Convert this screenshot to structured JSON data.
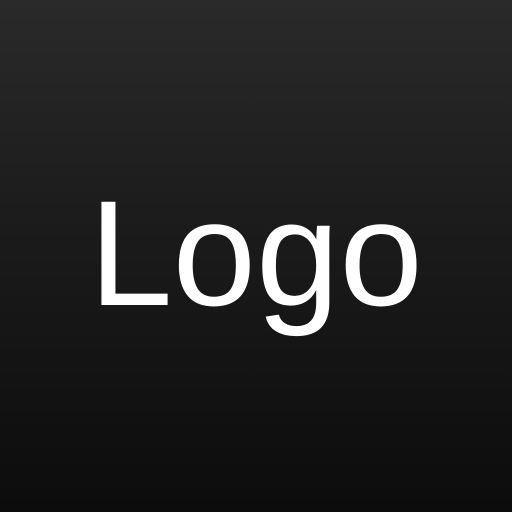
{
  "logo": {
    "text": "Logo",
    "text_color": "#ffffff"
  },
  "background": {
    "top_color": "#2a2a2a",
    "bottom_color": "#0c0c0c"
  }
}
